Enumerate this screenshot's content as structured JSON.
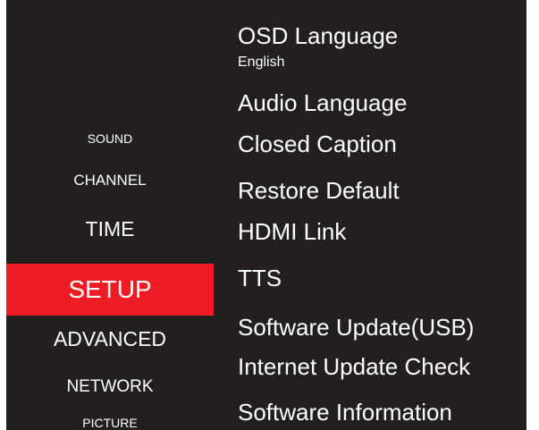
{
  "menu": {
    "items": [
      {
        "label": "SOUND"
      },
      {
        "label": "CHANNEL"
      },
      {
        "label": "TIME"
      },
      {
        "label": "SETUP",
        "active": true
      },
      {
        "label": "ADVANCED"
      },
      {
        "label": "NETWORK"
      },
      {
        "label": "PICTURE"
      }
    ]
  },
  "setup": {
    "options": [
      {
        "label": "OSD Language",
        "value": "English"
      },
      {
        "label": "Audio Language"
      },
      {
        "label": "Closed Caption"
      },
      {
        "label": "Restore Default"
      },
      {
        "label": "HDMI Link"
      },
      {
        "label": "TTS"
      },
      {
        "label": "Software Update(USB)"
      },
      {
        "label": "Internet Update Check"
      },
      {
        "label": "Software Information"
      }
    ]
  },
  "colors": {
    "background": "#231f20",
    "highlight": "#ed1c24",
    "text": "#ffffff"
  }
}
